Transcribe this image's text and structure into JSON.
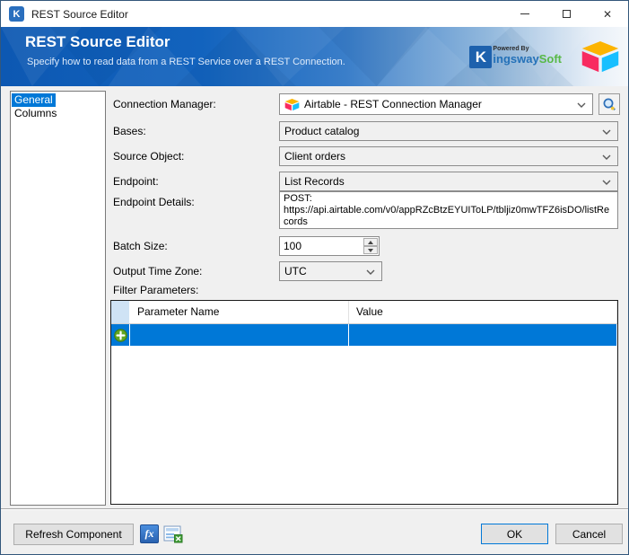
{
  "window": {
    "title": "REST Source Editor",
    "icon_letter": "K"
  },
  "header": {
    "title": "REST Source Editor",
    "subtitle": "Specify how to read data from a REST Service over a REST Connection.",
    "kingswaysoft": {
      "powered_by": "Powered By",
      "k": "K",
      "name": "ingsway",
      "soft": "Soft"
    }
  },
  "sidebar": {
    "items": [
      {
        "label": "General",
        "selected": true
      },
      {
        "label": "Columns",
        "selected": false
      }
    ]
  },
  "form": {
    "connection_manager": {
      "label": "Connection Manager:",
      "value": "Airtable - REST Connection Manager"
    },
    "bases": {
      "label": "Bases:",
      "value": "Product catalog"
    },
    "source_object": {
      "label": "Source Object:",
      "value": "Client orders"
    },
    "endpoint": {
      "label": "Endpoint:",
      "value": "List Records"
    },
    "endpoint_details": {
      "label": "Endpoint Details:",
      "value": "POST:\nhttps://api.airtable.com/v0/appRZcBtzEYUIToLP/tbljiz0mwTFZ6isDO/listRecords"
    },
    "batch_size": {
      "label": "Batch Size:",
      "value": "100"
    },
    "output_time_zone": {
      "label": "Output Time Zone:",
      "value": "UTC"
    },
    "filter_parameters": {
      "label": "Filter Parameters:",
      "columns": [
        "Parameter Name",
        "Value"
      ],
      "rows": [
        {
          "parameter_name": "",
          "value": ""
        }
      ]
    }
  },
  "footer": {
    "refresh_label": "Refresh Component",
    "ok_label": "OK",
    "cancel_label": "Cancel"
  },
  "icons": {
    "expression": "fx",
    "close": "✕",
    "search": "magnifier",
    "add_row": "green-plus",
    "dropdown": "chevron-down"
  },
  "colors": {
    "accent": "#0078d7",
    "header_blue": "#1263be",
    "selection_blue": "#0078d7",
    "airtable_yellow": "#fcb400",
    "airtable_red": "#f82b60",
    "airtable_blue": "#18bfff",
    "kingsway_green": "#58b947",
    "add_icon_green": "#61a521"
  }
}
